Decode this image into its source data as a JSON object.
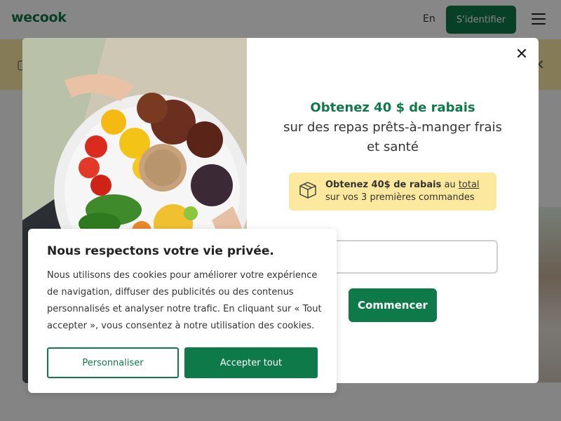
{
  "header": {
    "logo": "wecook",
    "lang": "En",
    "signin_label": "S'identifier"
  },
  "modal": {
    "headline_green": "Obtenez 40 $ de rabais",
    "headline_rest": "sur des repas prêts-à-manger frais et santé",
    "promo_bold": "Obtenez 40$ de rabais",
    "promo_au": " au ",
    "promo_total": "total",
    "promo_line2": "sur vos 3 premières commandes",
    "start_label": "Commencer"
  },
  "cookie": {
    "title": "Nous respectons votre vie privée.",
    "body": "Nous utilisons des cookies pour améliorer votre expérience de navigation, diffuser des publicités ou des contenus personnalisés et analyser notre trafic. En cliquant sur « Tout accepter », vous consentez à notre utilisation des cookies.",
    "customize_label": "Personnaliser",
    "accept_label": "Accepter tout"
  },
  "colors": {
    "brand": "#0e7a4a",
    "banner": "#fbe9a2",
    "promo_bg": "#fce99e"
  },
  "icons": {
    "menu": "hamburger-menu-icon",
    "close": "close-icon",
    "promo": "box-icon"
  }
}
